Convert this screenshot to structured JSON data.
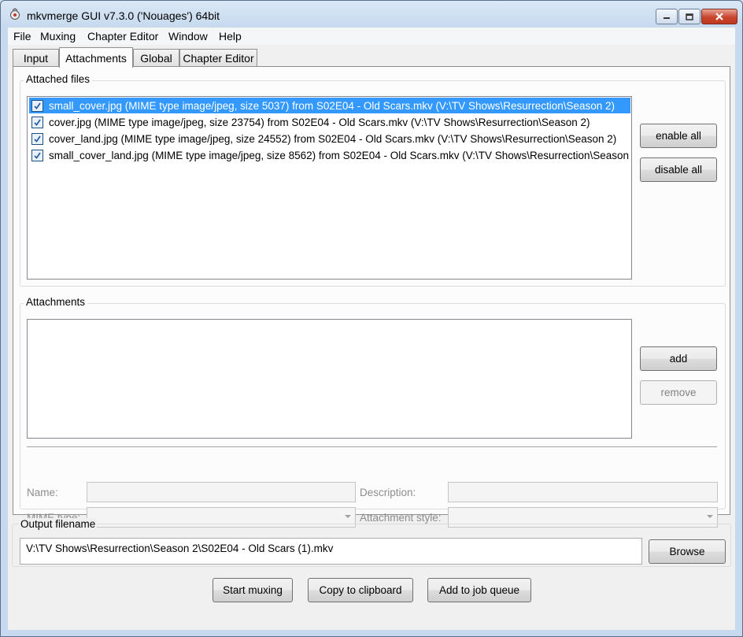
{
  "window": {
    "title": "mkvmerge GUI v7.3.0 ('Nouages') 64bit",
    "icon": "mkvmerge-app-icon"
  },
  "menu": [
    "File",
    "Muxing",
    "Chapter Editor",
    "Window",
    "Help"
  ],
  "tabs": [
    "Input",
    "Attachments",
    "Global",
    "Chapter Editor"
  ],
  "active_tab": "Attachments",
  "attached_files": {
    "label": "Attached files",
    "items": [
      {
        "text": "small_cover.jpg (MIME type image/jpeg, size 5037) from S02E04 - Old Scars.mkv (V:\\TV Shows\\Resurrection\\Season 2)",
        "checked": true,
        "selected": true
      },
      {
        "text": "cover.jpg (MIME type image/jpeg, size 23754) from S02E04 - Old Scars.mkv (V:\\TV Shows\\Resurrection\\Season 2)",
        "checked": true,
        "selected": false
      },
      {
        "text": "cover_land.jpg (MIME type image/jpeg, size 24552) from S02E04 - Old Scars.mkv (V:\\TV Shows\\Resurrection\\Season 2)",
        "checked": true,
        "selected": false
      },
      {
        "text": "small_cover_land.jpg (MIME type image/jpeg, size 8562) from S02E04 - Old Scars.mkv (V:\\TV Shows\\Resurrection\\Season",
        "checked": true,
        "selected": false
      }
    ],
    "enable_all": "enable all",
    "disable_all": "disable all"
  },
  "attachments": {
    "label": "Attachments",
    "add": "add",
    "remove": "remove",
    "name_label": "Name:",
    "description_label": "Description:",
    "mime_label": "MIME type:",
    "style_label": "Attachment style:"
  },
  "output": {
    "label": "Output filename",
    "value": "V:\\TV Shows\\Resurrection\\Season 2\\S02E04 - Old Scars (1).mkv",
    "browse": "Browse"
  },
  "actions": {
    "start": "Start muxing",
    "copy": "Copy to clipboard",
    "queue": "Add to job queue"
  },
  "colors": {
    "selection": "#3399ff",
    "title_bar": "#c6d9ee",
    "close_button": "#c7452d"
  }
}
